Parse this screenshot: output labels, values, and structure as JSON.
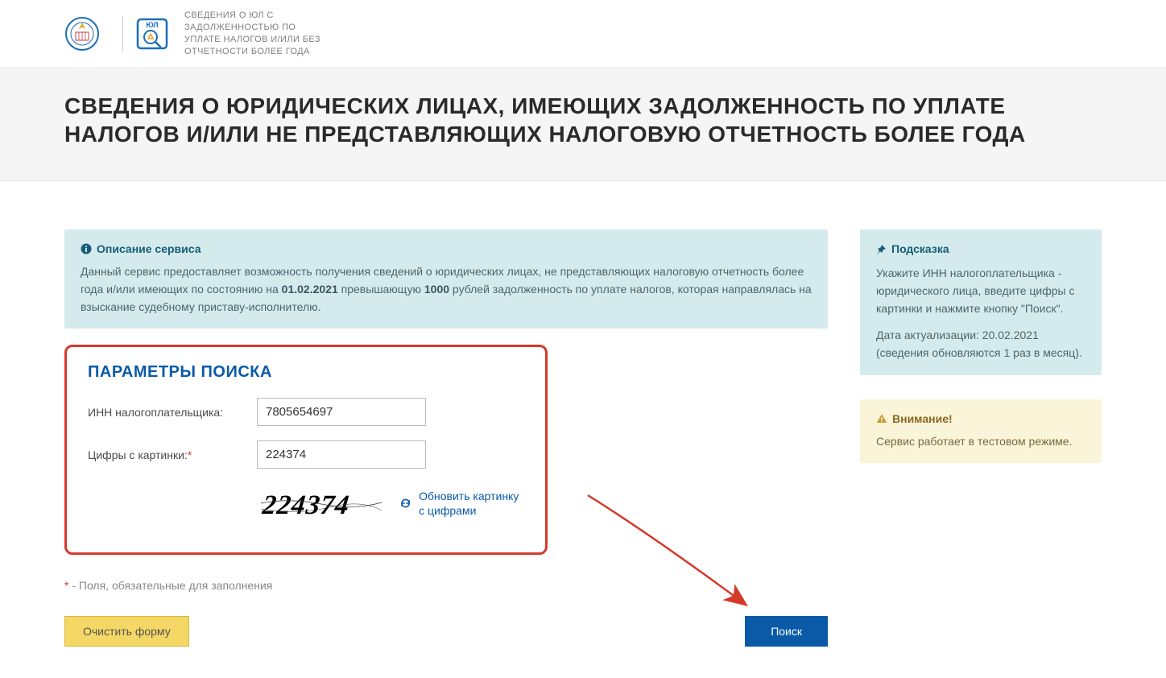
{
  "header": {
    "subtitle": "СВЕДЕНИЯ О ЮЛ С ЗАДОЛЖЕННОСТЬЮ ПО УПЛАТЕ НАЛОГОВ И/ИЛИ БЕЗ ОТЧЕТНОСТИ БОЛЕЕ ГОДА",
    "service_badge": "ЮЛ"
  },
  "title": "СВЕДЕНИЯ О ЮРИДИЧЕСКИХ ЛИЦАХ, ИМЕЮЩИХ ЗАДОЛЖЕННОСТЬ ПО УПЛАТЕ НАЛОГОВ И/ИЛИ НЕ ПРЕДСТАВЛЯЮЩИХ НАЛОГОВУЮ ОТЧЕТНОСТЬ БОЛЕЕ ГОДА",
  "info": {
    "title": "Описание сервиса",
    "text1": "Данный сервис предоставляет возможность получения сведений о юридических лицах, не представляющих налоговую отчетность более года и/или имеющих по состоянию на ",
    "date": "01.02.2021",
    "text2": " превышающую ",
    "amount": "1000",
    "text3": " рублей задолженность по уплате налогов, которая направлялась на взыскание судебному приставу-исполнителю."
  },
  "search": {
    "title": "ПАРАМЕТРЫ ПОИСКА",
    "inn_label": "ИНН налогоплательщика:",
    "inn_value": "7805654697",
    "captcha_label": "Цифры с картинки:",
    "captcha_value": "224374",
    "captcha_image_text": "224374",
    "refresh_label": "Обновить картинку с цифрами"
  },
  "required_note": " - Поля, обязательные для заполнения",
  "buttons": {
    "clear": "Очистить форму",
    "search": "Поиск"
  },
  "hint": {
    "title": "Подсказка",
    "text1": "Укажите ИНН налогоплательщика - юридического лица, введите цифры с картинки и нажмите кнопку \"Поиск\".",
    "text2": "Дата актуализации: 20.02.2021 (сведения обновляются 1 раз в месяц)."
  },
  "warn": {
    "title": "Внимание!",
    "text": "Сервис работает в тестовом режиме."
  }
}
